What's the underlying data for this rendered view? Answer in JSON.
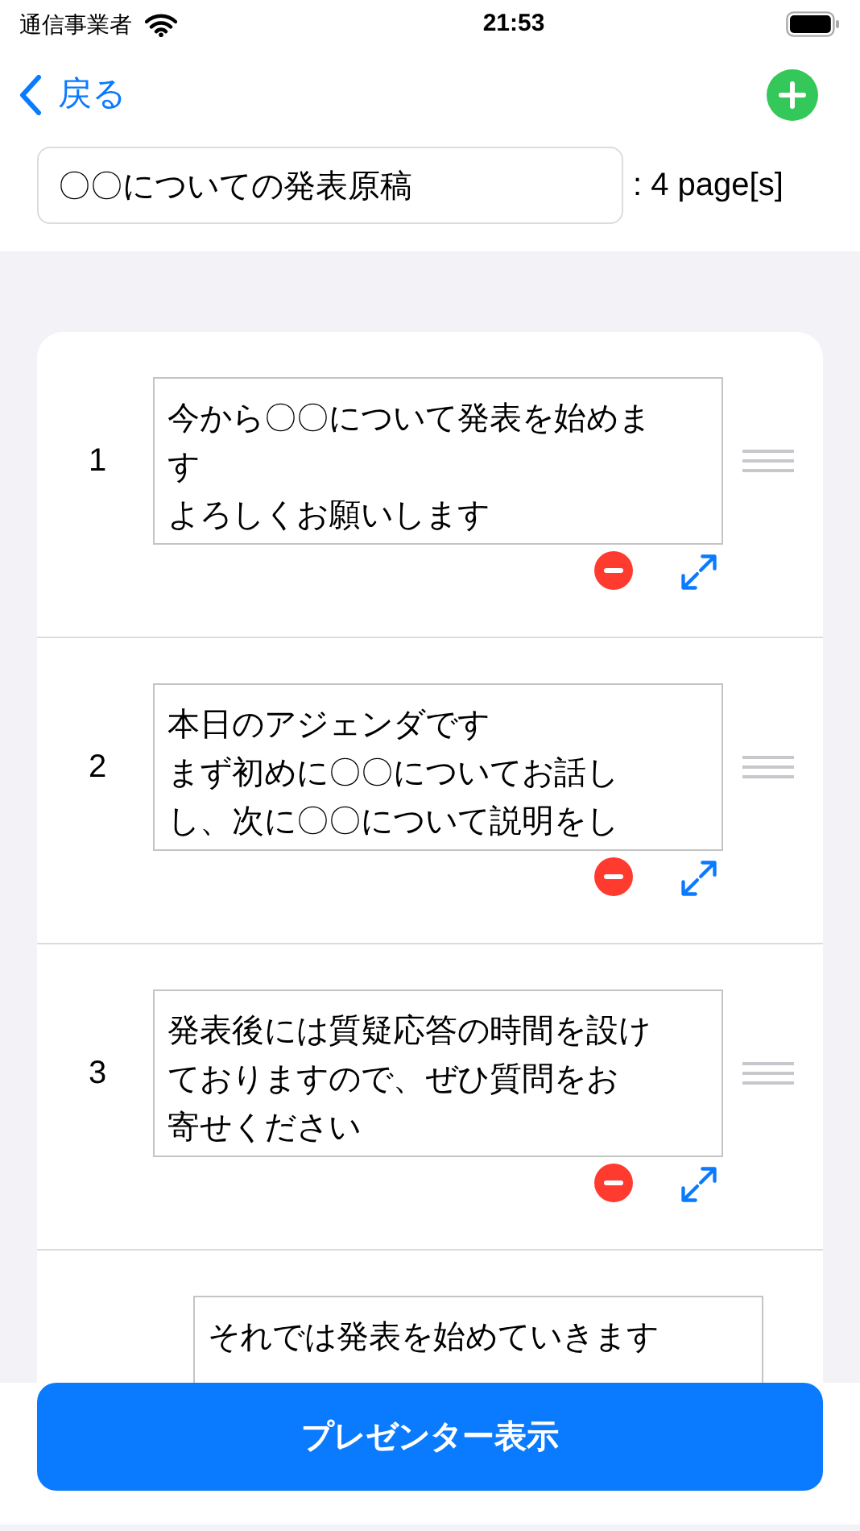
{
  "status_bar": {
    "carrier": "通信事業者",
    "time": "21:53"
  },
  "nav": {
    "back": "戻る"
  },
  "title_field": {
    "value": "〇〇についての発表原稿"
  },
  "page_count": ": 4 page[s]",
  "pages": [
    {
      "number": "1",
      "lines": [
        "今から〇〇について発表を始めま",
        "す",
        "よろしくお願いします"
      ]
    },
    {
      "number": "2",
      "lines": [
        "本日のアジェンダです",
        "まず初めに〇〇についてお話し",
        "し、次に〇〇について説明をし"
      ]
    },
    {
      "number": "3",
      "lines": [
        "発表後には質疑応答の時間を設け",
        "ておりますので、ぜひ質問をお",
        "寄せください"
      ]
    },
    {
      "lines": [
        "それでは発表を始めていきます"
      ]
    }
  ],
  "present_button": "プレゼンター表示"
}
